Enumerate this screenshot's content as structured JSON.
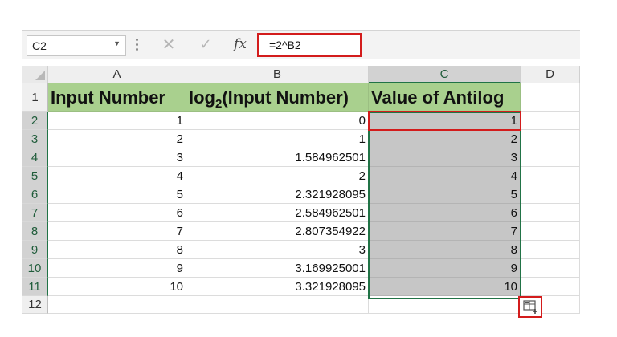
{
  "name_box": {
    "value": "C2"
  },
  "formula_bar": {
    "cancel_icon": "cancel-icon",
    "enter_icon": "check-icon",
    "function_label": "fx",
    "formula": "=2^B2"
  },
  "columns": [
    "A",
    "B",
    "C",
    "D"
  ],
  "rows": [
    "1",
    "2",
    "3",
    "4",
    "5",
    "6",
    "7",
    "8",
    "9",
    "10",
    "11",
    "12"
  ],
  "headers": {
    "a": "Input Number",
    "b_prefix": "log",
    "b_sub": "2",
    "b_suffix": "(Input Number)",
    "c": "Value of Antilog"
  },
  "data_rows": [
    {
      "a": "1",
      "b": "0",
      "c": "1"
    },
    {
      "a": "2",
      "b": "1",
      "c": "2"
    },
    {
      "a": "3",
      "b": "1.584962501",
      "c": "3"
    },
    {
      "a": "4",
      "b": "2",
      "c": "4"
    },
    {
      "a": "5",
      "b": "2.321928095",
      "c": "5"
    },
    {
      "a": "6",
      "b": "2.584962501",
      "c": "6"
    },
    {
      "a": "7",
      "b": "2.807354922",
      "c": "7"
    },
    {
      "a": "8",
      "b": "3",
      "c": "8"
    },
    {
      "a": "9",
      "b": "3.169925001",
      "c": "9"
    },
    {
      "a": "10",
      "b": "3.321928095",
      "c": "10"
    }
  ],
  "colors": {
    "header_fill": "#a9d08e",
    "selection_fill": "#c6c6c6",
    "selection_border": "#217346",
    "highlight": "#d31c1c"
  },
  "quick_analysis_icon": "quick-analysis-icon"
}
